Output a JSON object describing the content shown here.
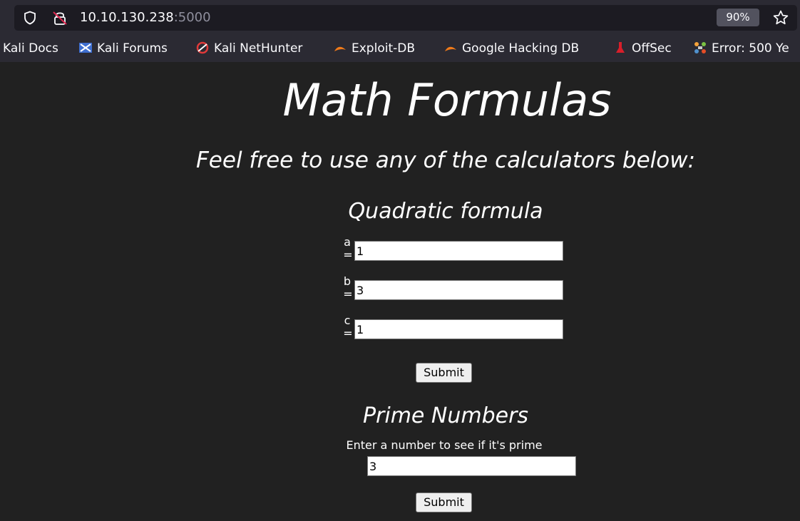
{
  "browser": {
    "url_host": "10.10.130.238",
    "url_port": ":5000",
    "zoom": "90%",
    "icons": [
      "shield-icon",
      "insecure-lock-icon",
      "star-icon"
    ],
    "bookmarks": [
      {
        "label": "Kali Docs",
        "icon": null
      },
      {
        "label": "Kali Forums",
        "icon": "kali-forums-icon"
      },
      {
        "label": "Kali NetHunter",
        "icon": "kali-nethunter-icon"
      },
      {
        "label": "Exploit-DB",
        "icon": "exploit-db-icon"
      },
      {
        "label": "Google Hacking DB",
        "icon": "exploit-db-icon"
      },
      {
        "label": "OffSec",
        "icon": "offsec-icon"
      },
      {
        "label": "Error: 500 Ye",
        "icon": "joomla-icon"
      }
    ]
  },
  "page": {
    "title": "Math Formulas",
    "subtitle": "Feel free to use any of the calculators below:",
    "quadratic": {
      "heading": "Quadratic formula",
      "fields": [
        {
          "label_top": "a",
          "label_bottom": "=",
          "value": "1"
        },
        {
          "label_top": "b",
          "label_bottom": "=",
          "value": "3"
        },
        {
          "label_top": "c",
          "label_bottom": "=",
          "value": "1"
        }
      ],
      "submit_label": "Submit"
    },
    "prime": {
      "heading": "Prime Numbers",
      "description": "Enter a number to see if it's prime",
      "value": "3",
      "submit_label": "Submit"
    }
  },
  "colors": {
    "page_background": "#212121",
    "chrome_background": "#2b2a33",
    "text": "#ffffff"
  }
}
